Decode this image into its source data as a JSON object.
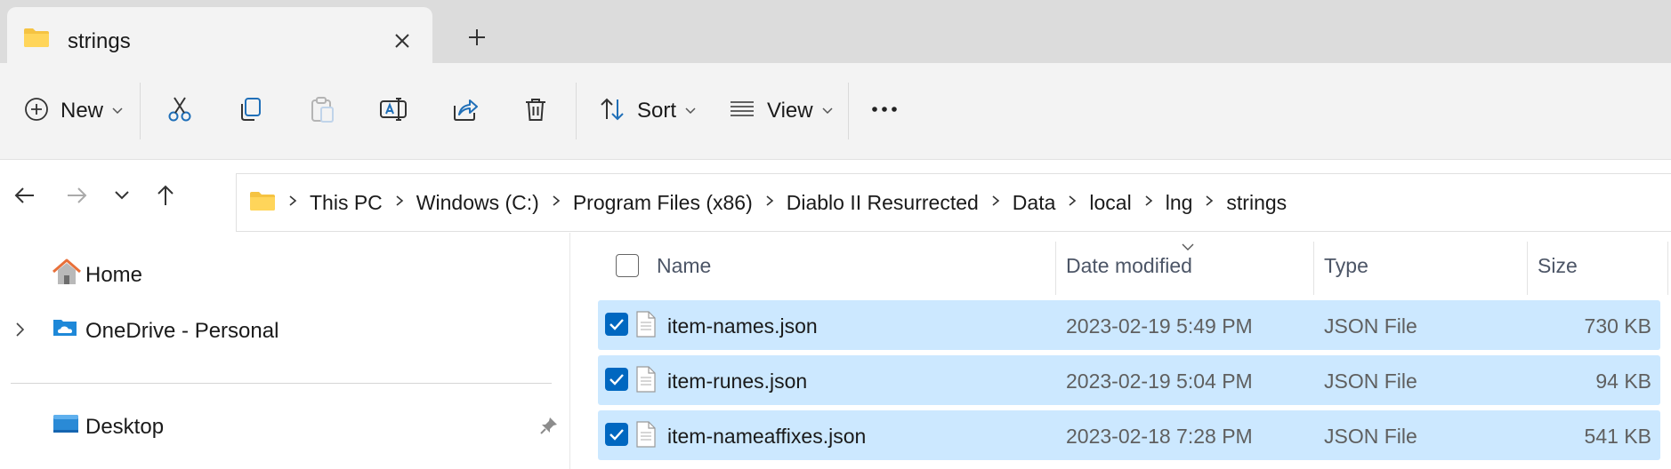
{
  "tab": {
    "title": "strings"
  },
  "toolbar": {
    "new_label": "New",
    "sort_label": "Sort",
    "view_label": "View"
  },
  "breadcrumb": [
    "This PC",
    "Windows (C:)",
    "Program Files (x86)",
    "Diablo II Resurrected",
    "Data",
    "local",
    "lng",
    "strings"
  ],
  "sidebar": {
    "home": "Home",
    "onedrive": "OneDrive - Personal",
    "desktop": "Desktop"
  },
  "columns": {
    "name": "Name",
    "date": "Date modified",
    "type": "Type",
    "size": "Size"
  },
  "files": [
    {
      "name": "item-names.json",
      "date": "2023-02-19 5:49 PM",
      "type": "JSON File",
      "size": "730 KB",
      "selected": true
    },
    {
      "name": "item-runes.json",
      "date": "2023-02-19 5:04 PM",
      "type": "JSON File",
      "size": "94 KB",
      "selected": true
    },
    {
      "name": "item-nameaffixes.json",
      "date": "2023-02-18 7:28 PM",
      "type": "JSON File",
      "size": "541 KB",
      "selected": true
    }
  ],
  "colors": {
    "selection": "#cce8ff",
    "accent": "#0067c0",
    "folder": "#f5c342"
  }
}
